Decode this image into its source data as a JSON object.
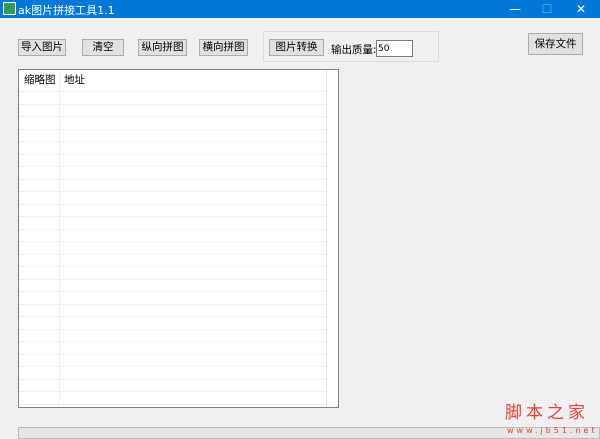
{
  "window": {
    "title": "ak图片拼接工具1.1",
    "minimize": "—",
    "maximize": "☐",
    "close": "✕"
  },
  "toolbar": {
    "import": "导入图片",
    "clear": "清空",
    "vertical": "纵向拼图",
    "horizontal": "横向拼图",
    "convert": "图片转换",
    "quality_label": "输出质量:",
    "quality_value": "50",
    "save": "保存文件"
  },
  "table": {
    "columns": [
      "缩略图",
      "地址"
    ],
    "rows": []
  },
  "progress": {
    "value": 0
  },
  "watermark": {
    "name": "脚本之家",
    "url": "www.jb51.net"
  }
}
